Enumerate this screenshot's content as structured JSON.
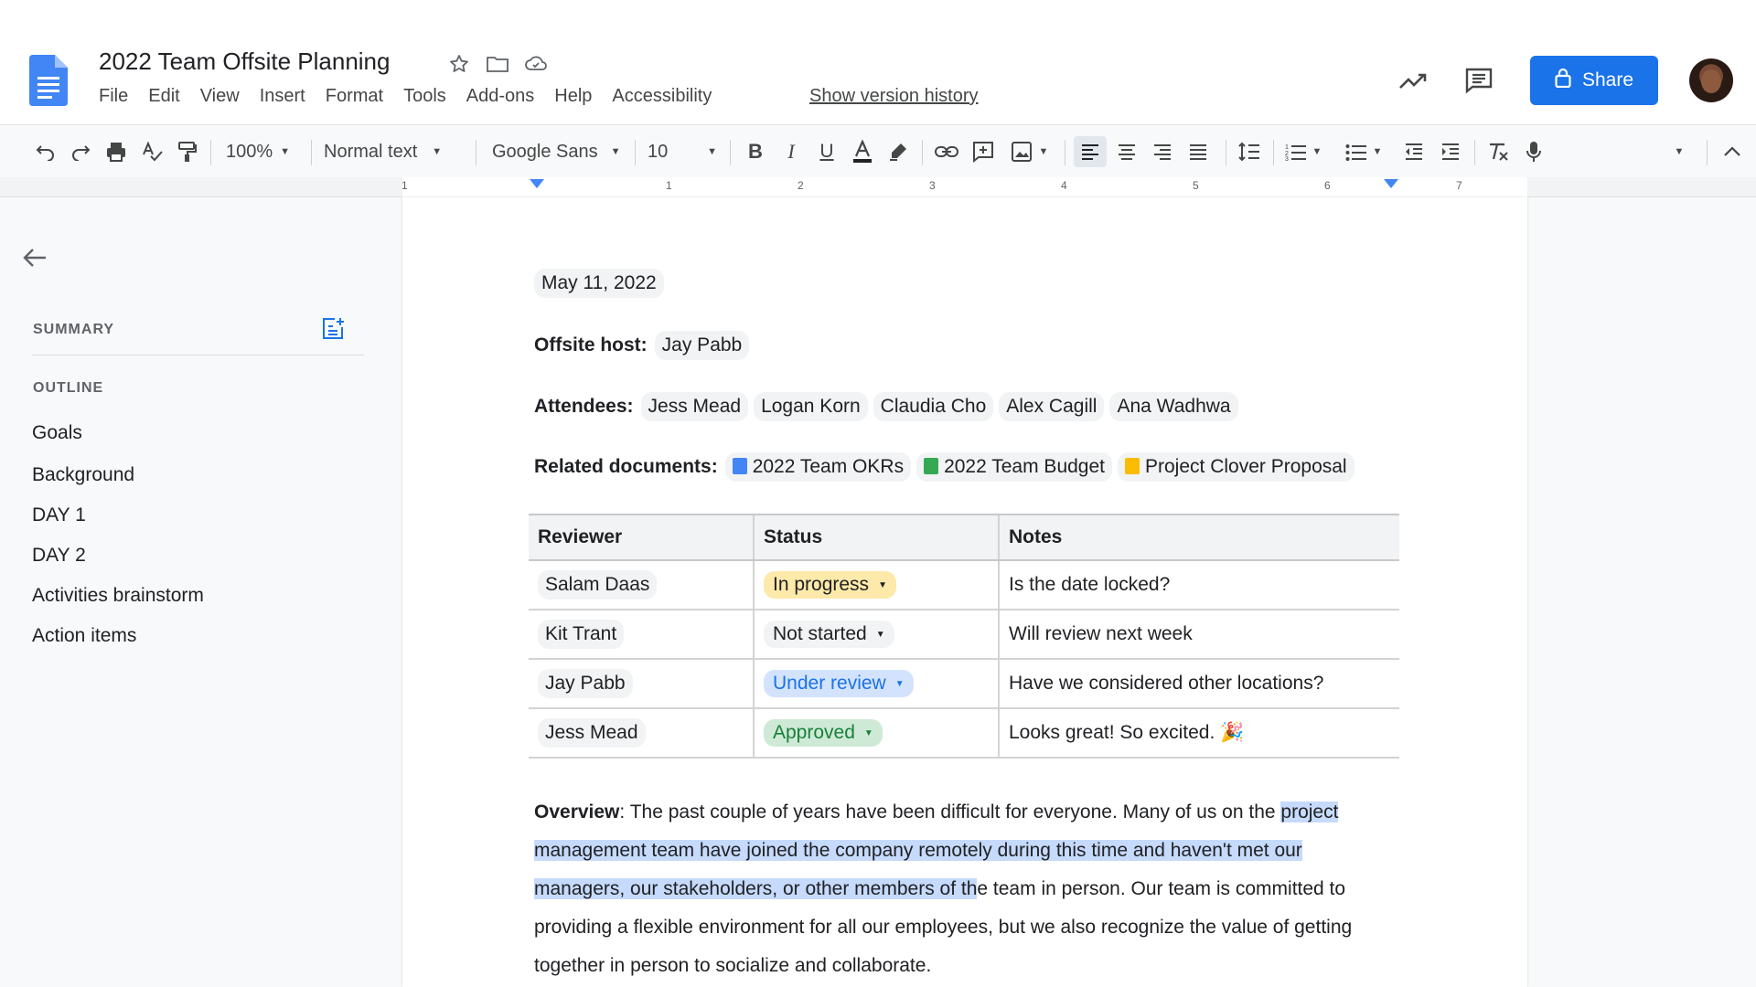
{
  "header": {
    "doc_title": "2022 Team Offsite Planning",
    "menu": [
      "File",
      "Edit",
      "View",
      "Insert",
      "Format",
      "Tools",
      "Add-ons",
      "Help",
      "Accessibility"
    ],
    "version_history": "Show version history",
    "share_label": "Share",
    "colors": {
      "share_bg": "#1a73e8",
      "docs_blue": "#4285f4"
    }
  },
  "toolbar": {
    "zoom": "100%",
    "style": "Normal text",
    "font": "Google Sans",
    "font_size": "10"
  },
  "ruler": {
    "labels": [
      "1",
      "1",
      "2",
      "3",
      "4",
      "5",
      "6",
      "7"
    ]
  },
  "sidebar": {
    "summary_heading": "SUMMARY",
    "outline_heading": "OUTLINE",
    "outline_items": [
      "Goals",
      "Background",
      "DAY 1",
      "DAY 2",
      "Activities brainstorm",
      "Action items"
    ]
  },
  "doc": {
    "date_chip": "May 11, 2022",
    "host_label": "Offsite host:",
    "host": "Jay Pabb",
    "attendees_label": "Attendees:",
    "attendees": [
      "Jess Mead",
      "Logan Korn",
      "Claudia Cho",
      "Alex Cagill",
      "Ana Wadhwa"
    ],
    "related_label": "Related documents:",
    "related": [
      {
        "name": "2022 Team OKRs",
        "icon": "docs-icon",
        "color": "#4285f4"
      },
      {
        "name": "2022 Team Budget",
        "icon": "sheets-icon",
        "color": "#34a853"
      },
      {
        "name": "Project Clover Proposal",
        "icon": "slides-icon",
        "color": "#fbbc04"
      }
    ],
    "table": {
      "headers": [
        "Reviewer",
        "Status",
        "Notes"
      ],
      "rows": [
        {
          "reviewer": "Salam Daas",
          "status": "In progress",
          "status_bg": "#fde9a9",
          "status_fg": "#202124",
          "notes": "Is the date locked?"
        },
        {
          "reviewer": "Kit Trant",
          "status": "Not started",
          "status_bg": "#f1f3f4",
          "status_fg": "#202124",
          "notes": "Will review next week"
        },
        {
          "reviewer": "Jay Pabb",
          "status": "Under review",
          "status_bg": "#d3e3fd",
          "status_fg": "#1a73e8",
          "notes": "Have we considered other locations?"
        },
        {
          "reviewer": "Jess Mead",
          "status": "Approved",
          "status_bg": "#ceead6",
          "status_fg": "#188038",
          "notes": "Looks great! So excited. 🎉"
        }
      ]
    },
    "overview_label": "Overview",
    "overview_a": ": The past couple of years have been difficult for everyone. Many of us on the ",
    "overview_hl": "project management team have joined the company remotely during this time and haven't met our managers, our stakeholders, or other members of th",
    "overview_b": "e team in person. Our team is committed to providing a flexible environment for all our employees, but we also recognize the value of getting together in person to socialize and collaborate."
  }
}
